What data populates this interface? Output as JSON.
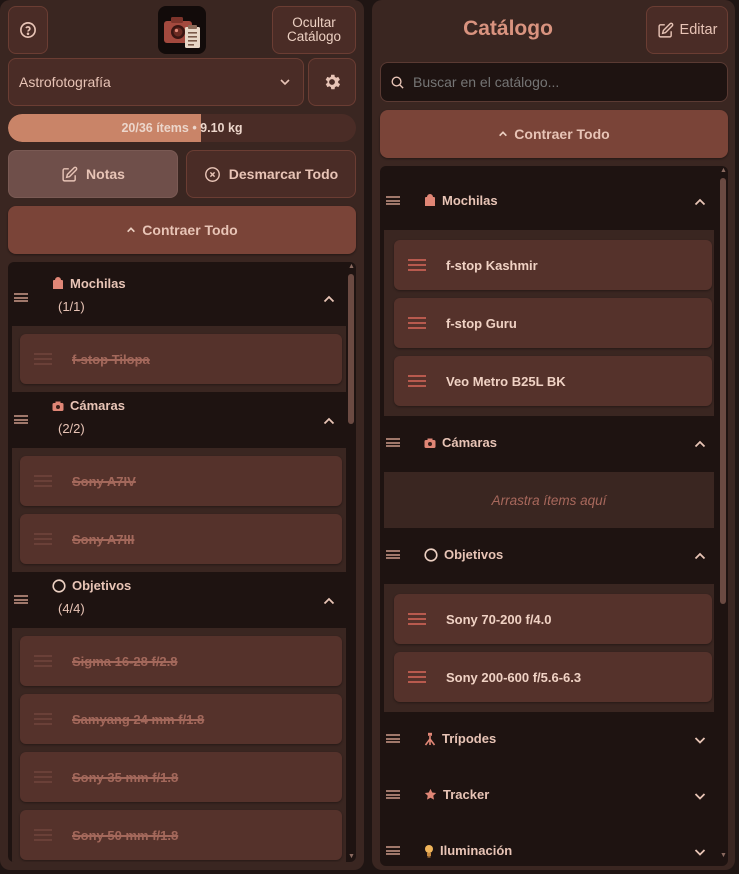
{
  "left": {
    "help_icon": "question-circle-icon",
    "app_logo": "camera-checklist-logo",
    "hide_catalog_label": "Ocultar\nCatálogo",
    "profile_select_value": "Astrofotografía",
    "progress_text": "20/36 ítems • 9.10 kg",
    "progress_fraction": 0.555,
    "notes_label": "Notas",
    "unmark_all_label": "Desmarcar Todo",
    "collapse_all_label": "Contraer Todo",
    "categories": [
      {
        "name": "Mochilas",
        "count": "(1/1)",
        "items": [
          "f-stop Tilopa"
        ]
      },
      {
        "name": "Cámaras",
        "count": "(2/2)",
        "items": [
          "Sony A7IV",
          "Sony A7III"
        ]
      },
      {
        "name": "Objetivos",
        "count": "(4/4)",
        "items": [
          "Sigma 16-28 f/2.8",
          "Samyang 24 mm f/1.8",
          "Sony 35 mm f/1.8",
          "Sony 50 mm f/1.8"
        ]
      }
    ]
  },
  "right": {
    "title": "Catálogo",
    "edit_label": "Editar",
    "search_placeholder": "Buscar en el catálogo...",
    "collapse_all_label": "Contraer Todo",
    "empty_drop_text": "Arrastra ítems aquí",
    "categories": [
      {
        "name": "Mochilas",
        "items": [
          "f-stop Kashmir",
          "f-stop Guru",
          "Veo Metro B25L BK"
        ]
      },
      {
        "name": "Cámaras",
        "items": []
      },
      {
        "name": "Objetivos",
        "items": [
          "Sony 70-200 f/4.0",
          "Sony 200-600 f/5.6-6.3"
        ]
      },
      {
        "name": "Trípodes"
      },
      {
        "name": "Tracker"
      },
      {
        "name": "Iluminación"
      }
    ]
  },
  "colors": {
    "background": "#1f1513",
    "panel": "#3a2621",
    "accent": "#7a4438",
    "title": "#d9937f",
    "progress_fill": "#c98468"
  }
}
